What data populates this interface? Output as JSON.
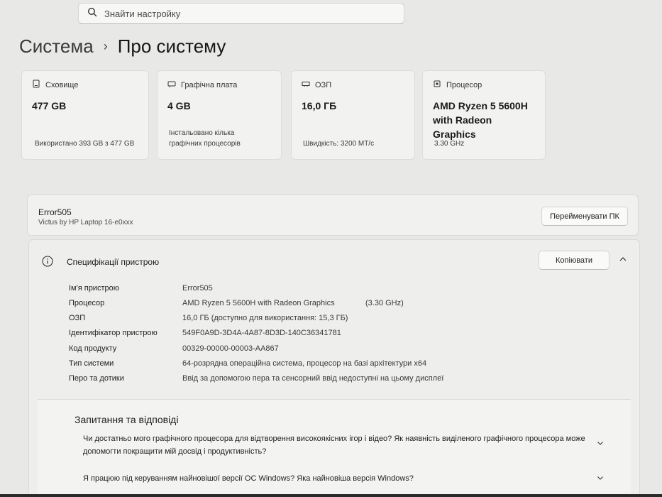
{
  "search": {
    "placeholder": "Знайти настройку",
    "icon": "search-icon"
  },
  "breadcrumb": {
    "parent": "Система",
    "separator": "›",
    "current": "Про систему"
  },
  "cards": [
    {
      "icon": "storage-icon",
      "title": "Сховище",
      "value": "477 GB",
      "sub": "Використано 393 GB з 477 GB"
    },
    {
      "icon": "gpu-icon",
      "title": "Графічна плата",
      "value": "4 GB",
      "sub": "Інстальовано кілька графічних процесорів"
    },
    {
      "icon": "ram-icon",
      "title": "ОЗП",
      "value": "16,0 ГБ",
      "sub": "Швидкість: 3200 МТ/с"
    },
    {
      "icon": "cpu-icon",
      "title": "Процесор",
      "value": "AMD Ryzen 5 5600H with Radeon Graphics",
      "sub": "3.30 GHz"
    }
  ],
  "device": {
    "name": "Error505",
    "model": "Victus by HP Laptop 16-e0xxx",
    "rename_label": "Перейменувати ПК"
  },
  "specs": {
    "title": "Специфікації пристрою",
    "copy_label": "Копіювати",
    "rows": [
      {
        "label": "Ім'я пристрою",
        "value": "Error505"
      },
      {
        "label": "Процесор",
        "value": "AMD Ryzen 5 5600H with Radeon Graphics",
        "extra": "(3.30 GHz)"
      },
      {
        "label": "ОЗП",
        "value": "16,0 ГБ (доступно для використання: 15,3 ГБ)"
      },
      {
        "label": "Ідентифікатор пристрою",
        "value": "549F0A9D-3D4A-4A87-8D3D-140C36341781"
      },
      {
        "label": "Код продукту",
        "value": "00329-00000-00003-AA867"
      },
      {
        "label": "Тип системи",
        "value": "64-розрядна операційна система, процесор на базі архітектури x64"
      },
      {
        "label": "Перо та дотики",
        "value": "Ввід за допомогою пера та сенсорний ввід недоступні на цьому дисплеї"
      }
    ]
  },
  "faq": {
    "title": "Запитання та відповіді",
    "questions": [
      "Чи достатньо мого графічного процесора для відтворення високоякісних ігор і відео? Як наявність виділеного графічного процесора може допомогти покращити мій досвід і продуктивність?",
      "Я працюю під керуванням найновішої версії ОС Windows? Яка найновіша версія Windows?"
    ]
  }
}
